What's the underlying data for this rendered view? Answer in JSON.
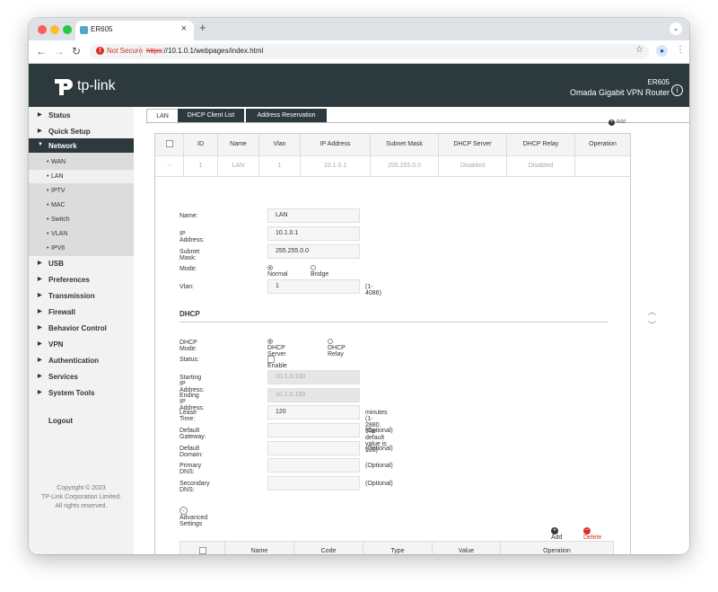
{
  "browser": {
    "tab_title": "ER605",
    "tab_close": "×",
    "new_tab": "+",
    "not_secure": "Not Secure",
    "url_scheme": "https",
    "url_rest": "://10.1.0.1/webpages/index.html"
  },
  "header": {
    "logo_text": "tp-link",
    "model": "ER605",
    "product": "Omada Gigabit VPN Router"
  },
  "sidebar": {
    "items": [
      {
        "label": "Status"
      },
      {
        "label": "Quick Setup"
      },
      {
        "label": "Network"
      },
      {
        "label": "USB"
      },
      {
        "label": "Preferences"
      },
      {
        "label": "Transmission"
      },
      {
        "label": "Firewall"
      },
      {
        "label": "Behavior Control"
      },
      {
        "label": "VPN"
      },
      {
        "label": "Authentication"
      },
      {
        "label": "Services"
      },
      {
        "label": "System Tools"
      }
    ],
    "network_sub": [
      {
        "label": "WAN"
      },
      {
        "label": "LAN"
      },
      {
        "label": "IPTV"
      },
      {
        "label": "MAC"
      },
      {
        "label": "Switch"
      },
      {
        "label": "VLAN"
      },
      {
        "label": "IPV6"
      }
    ],
    "logout": "Logout",
    "copyright_1": "Copyright © 2023",
    "copyright_2": "TP-Link Corporation Limited.",
    "copyright_3": "All rights reserved."
  },
  "tabs": [
    {
      "label": "LAN"
    },
    {
      "label": "DHCP Client List"
    },
    {
      "label": "Address Reservation"
    }
  ],
  "add_label": "Add",
  "delete_label": "Delete",
  "table": {
    "headers": [
      "ID",
      "Name",
      "Vlan",
      "IP Address",
      "Subnet Mask",
      "DHCP Server",
      "DHCP Relay",
      "Operation"
    ],
    "row": [
      "--",
      "1",
      "LAN",
      "1",
      "10.1.0.1",
      "255.255.0.0",
      "Disabled",
      "Disabled",
      ""
    ]
  },
  "form": {
    "name_label": "Name:",
    "name_value": "LAN",
    "ip_label": "IP Address:",
    "ip_value": "10.1.0.1",
    "mask_label": "Subnet Mask:",
    "mask_value": "255.255.0.0",
    "mode_label": "Mode:",
    "mode_normal": "Normal",
    "mode_bridge": "Bridge",
    "vlan_label": "Vlan:",
    "vlan_value": "1",
    "vlan_hint": "(1-4086)"
  },
  "dhcp": {
    "section_title": "DHCP",
    "mode_label": "DHCP Mode:",
    "mode_server": "DHCP Server",
    "mode_relay": "DHCP Relay",
    "status_label": "Status:",
    "status_enable": "Enable",
    "start_label": "Starting IP Address:",
    "start_value": "10.1.0.100",
    "end_label": "Ending IP Address:",
    "end_value": "10.1.0.199",
    "lease_label": "Lease Time:",
    "lease_value": "120",
    "lease_hint": "minutes (1-2880. The default value is 120)",
    "gateway_label": "Default Gateway:",
    "domain_label": "Default Domain:",
    "pdns_label": "Primary DNS:",
    "sdns_label": "Secondary DNS:",
    "optional": "(Optional)"
  },
  "advanced": {
    "label": "Advanced Settings",
    "headers": [
      "Name",
      "Code",
      "Type",
      "Value",
      "Operation"
    ]
  },
  "colors": {
    "header_bg": "#2d3a3d",
    "active_menu": "#2d3a3d",
    "not_secure": "#d93025"
  }
}
